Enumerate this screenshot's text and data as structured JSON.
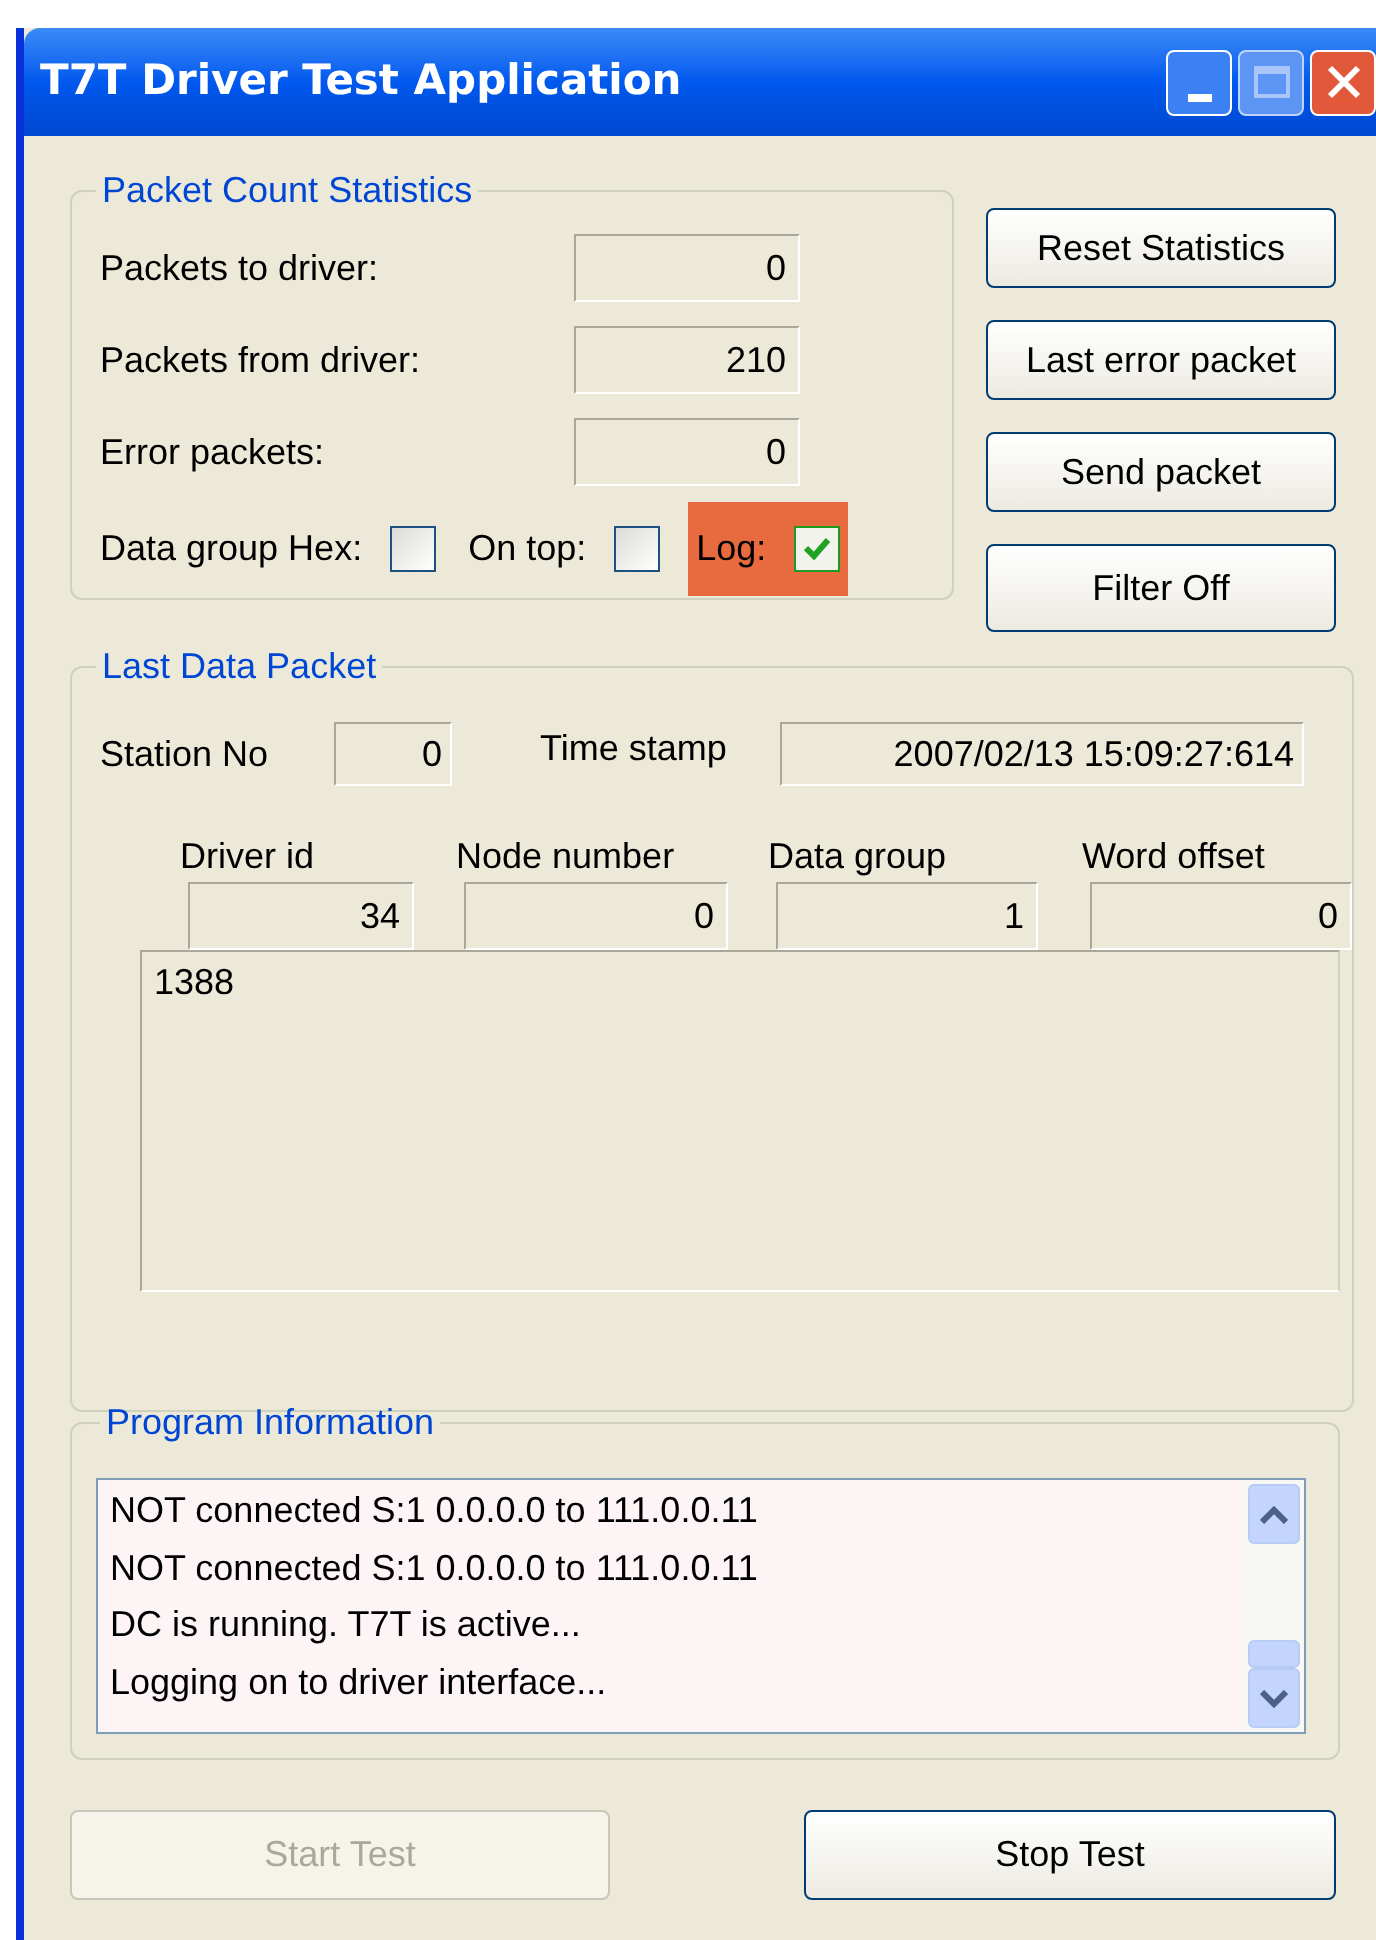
{
  "window": {
    "title": "T7T Driver Test Application"
  },
  "packet_count_statistics": {
    "title": "Packet Count Statistics",
    "rows": [
      {
        "label": "Packets to driver:",
        "value": "0"
      },
      {
        "label": "Packets from driver:",
        "value": "210"
      },
      {
        "label": "Error packets:",
        "value": "0"
      }
    ],
    "options": [
      {
        "label": "Data group Hex:",
        "checked": false,
        "highlighted": false
      },
      {
        "label": "On top:",
        "checked": false,
        "highlighted": false
      },
      {
        "label": "Log:",
        "checked": true,
        "highlighted": true
      }
    ]
  },
  "side_buttons": [
    {
      "label": "Reset Statistics"
    },
    {
      "label": "Last error packet"
    },
    {
      "label": "Send packet"
    },
    {
      "label": "Filter Off"
    }
  ],
  "last_data_packet": {
    "title": "Last Data Packet",
    "station_no": {
      "label": "Station No",
      "value": "0"
    },
    "time_stamp": {
      "label": "Time stamp",
      "value": "2007/02/13 15:09:27:614"
    },
    "columns": [
      {
        "label": "Driver id",
        "value": "34"
      },
      {
        "label": "Node number",
        "value": "0"
      },
      {
        "label": "Data group",
        "value": "1"
      },
      {
        "label": "Word offset",
        "value": "0"
      }
    ],
    "data": "1388"
  },
  "program_information": {
    "title": "Program Information",
    "lines": [
      "NOT connected S:1 0.0.0.0 to 111.0.0.11",
      "NOT connected S:1 0.0.0.0 to 111.0.0.11",
      "DC is running. T7T is active...",
      "Logging on to driver interface..."
    ]
  },
  "buttons": [
    {
      "label": "Start Test",
      "disabled": true
    },
    {
      "label": "Stop Test",
      "disabled": false
    }
  ]
}
